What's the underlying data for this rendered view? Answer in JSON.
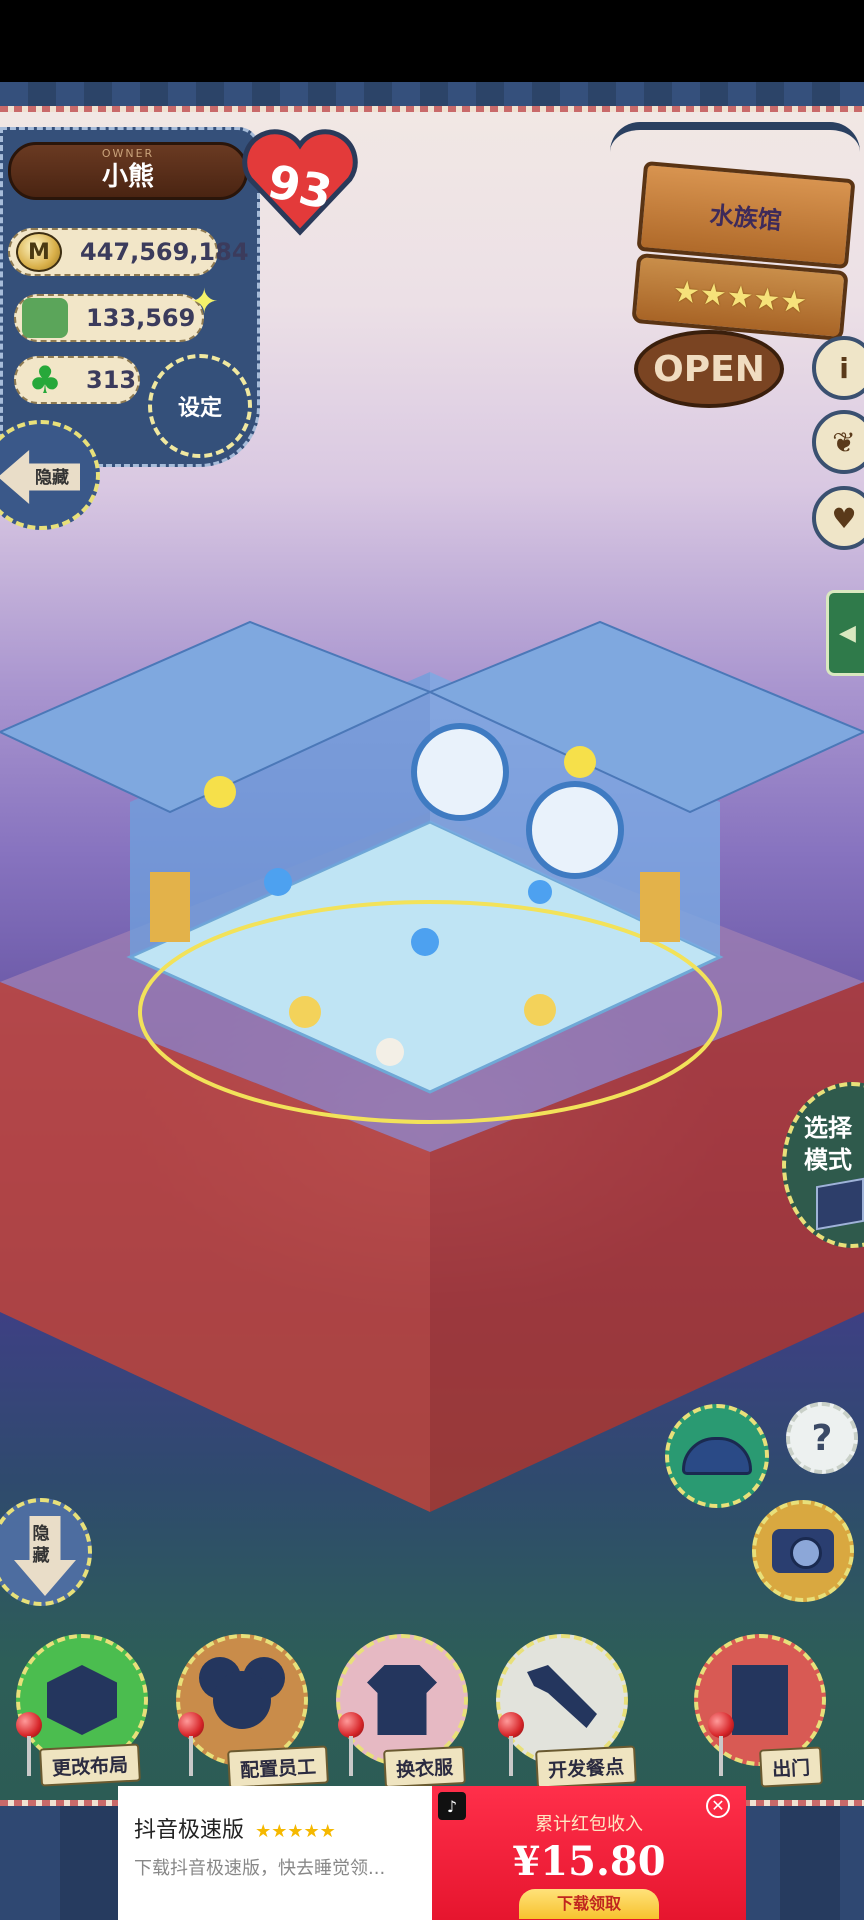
{
  "owner": {
    "sub_label": "OWNER",
    "name": "小熊",
    "level": "93"
  },
  "stats": {
    "coins": "447,569,184",
    "coin_icon": "M",
    "gems": "133,569",
    "clover": "313"
  },
  "buttons": {
    "settings": "设定",
    "hide_top": "隐藏",
    "hide_bottom": "隐藏",
    "mode": "选择模式",
    "help": "?",
    "info": "i"
  },
  "shop": {
    "name": "水族馆",
    "stars": "★★★★★",
    "open_sign": "OPEN",
    "rating": 5
  },
  "menu": [
    {
      "label": "更改布局",
      "icon": "box-icon"
    },
    {
      "label": "配置员工",
      "icon": "bear-icon"
    },
    {
      "label": "换衣服",
      "icon": "shirt-icon"
    },
    {
      "label": "开发餐点",
      "icon": "knife-icon"
    },
    {
      "label": "出门",
      "icon": "door-icon"
    }
  ],
  "ad": {
    "app_name": "抖音极速版",
    "stars": "★★★★★",
    "description": "下载抖音极速版，快去睡觉领...",
    "heading": "累计红包收入",
    "amount": "¥15.80",
    "cta": "下载领取",
    "close": "✕"
  },
  "colors": {
    "accent_stitch": "#e8e07a",
    "panel_blue": "#35507a",
    "ad_red": "#ff2f4a"
  }
}
